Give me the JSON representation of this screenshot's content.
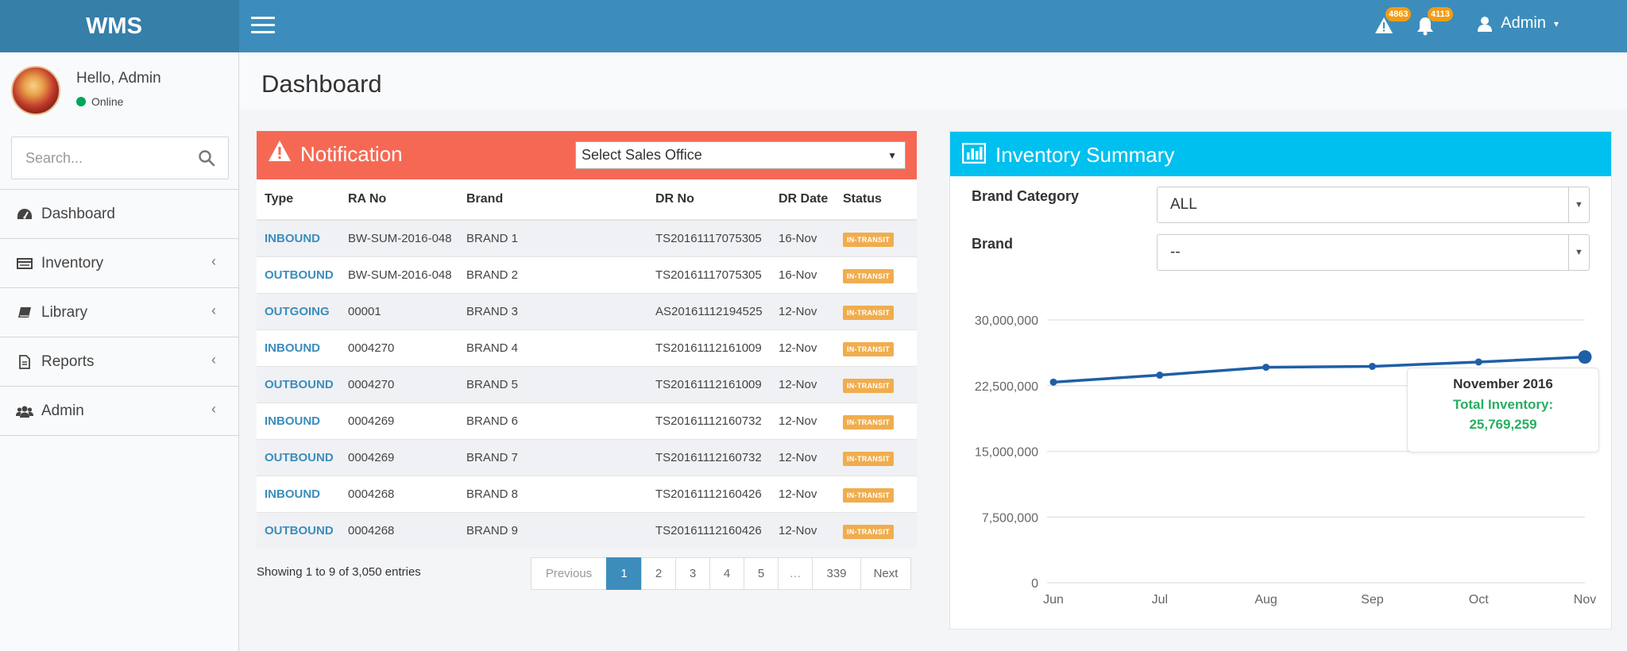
{
  "app": {
    "logo": "WMS"
  },
  "header": {
    "alerts_count": "4863",
    "notifications_count": "4113",
    "user_label": "Admin"
  },
  "sidebar": {
    "greeting_prefix": "Hello,",
    "greeting_name": "Admin",
    "status": "Online",
    "search_placeholder": "Search...",
    "items": [
      {
        "label": "Dashboard",
        "icon": "dashboard-icon"
      },
      {
        "label": "Inventory",
        "icon": "inventory-icon"
      },
      {
        "label": "Library",
        "icon": "book-icon"
      },
      {
        "label": "Reports",
        "icon": "file-icon"
      },
      {
        "label": "Admin",
        "icon": "users-icon"
      }
    ]
  },
  "page": {
    "title": "Dashboard"
  },
  "notification": {
    "title": "Notification",
    "sales_office_select": "Select Sales Office",
    "columns": [
      "Type",
      "RA No",
      "Brand",
      "DR No",
      "DR Date",
      "Status"
    ],
    "rows": [
      {
        "type": "INBOUND",
        "ra_no": "BW-SUM-2016-048",
        "brand": "BRAND 1",
        "dr_no": "TS20161117075305",
        "dr_date": "16-Nov",
        "status": "IN-TRANSIT"
      },
      {
        "type": "OUTBOUND",
        "ra_no": "BW-SUM-2016-048",
        "brand": "BRAND 2",
        "dr_no": "TS20161117075305",
        "dr_date": "16-Nov",
        "status": "IN-TRANSIT"
      },
      {
        "type": "OUTGOING",
        "ra_no": "00001",
        "brand": "BRAND 3",
        "dr_no": "AS20161112194525",
        "dr_date": "12-Nov",
        "status": "IN-TRANSIT"
      },
      {
        "type": "INBOUND",
        "ra_no": "0004270",
        "brand": "BRAND 4",
        "dr_no": "TS20161112161009",
        "dr_date": "12-Nov",
        "status": "IN-TRANSIT"
      },
      {
        "type": "OUTBOUND",
        "ra_no": "0004270",
        "brand": "BRAND 5",
        "dr_no": "TS20161112161009",
        "dr_date": "12-Nov",
        "status": "IN-TRANSIT"
      },
      {
        "type": "INBOUND",
        "ra_no": "0004269",
        "brand": "BRAND 6",
        "dr_no": "TS20161112160732",
        "dr_date": "12-Nov",
        "status": "IN-TRANSIT"
      },
      {
        "type": "OUTBOUND",
        "ra_no": "0004269",
        "brand": "BRAND 7",
        "dr_no": "TS20161112160732",
        "dr_date": "12-Nov",
        "status": "IN-TRANSIT"
      },
      {
        "type": "INBOUND",
        "ra_no": "0004268",
        "brand": "BRAND 8",
        "dr_no": "TS20161112160426",
        "dr_date": "12-Nov",
        "status": "IN-TRANSIT"
      },
      {
        "type": "OUTBOUND",
        "ra_no": "0004268",
        "brand": "BRAND 9",
        "dr_no": "TS20161112160426",
        "dr_date": "12-Nov",
        "status": "IN-TRANSIT"
      }
    ],
    "entries_info": "Showing 1 to 9 of 3,050 entries",
    "pagination": [
      "Previous",
      "1",
      "2",
      "3",
      "4",
      "5",
      "…",
      "339",
      "Next"
    ],
    "active_page": "1"
  },
  "inventory": {
    "title": "Inventory Summary",
    "brand_category_label": "Brand Category",
    "brand_category_value": "ALL",
    "brand_label": "Brand",
    "brand_value": "--",
    "tooltip": {
      "title": "November 2016",
      "label": "Total Inventory:",
      "value": "25,769,259"
    }
  },
  "colors": {
    "header": "#3c8dbc",
    "logo_bg": "#367fa9",
    "notification_header": "#f56954",
    "inventory_header": "#00c0ef",
    "status_label": "#f0ad4e",
    "line": "#1f5fa6",
    "tooltip_text": "#27ae60"
  },
  "chart_data": {
    "type": "line",
    "categories": [
      "Jun",
      "Jul",
      "Aug",
      "Sep",
      "Oct",
      "Nov"
    ],
    "series": [
      {
        "values": [
          22900000,
          23700000,
          24600000,
          24700000,
          25200000,
          25769259
        ]
      }
    ],
    "y_ticks": [
      "0",
      "7,500,000",
      "15,000,000",
      "22,500,000",
      "30,000,000"
    ],
    "ylim": [
      0,
      30000000
    ],
    "grid": true,
    "highlight_index": 5
  }
}
